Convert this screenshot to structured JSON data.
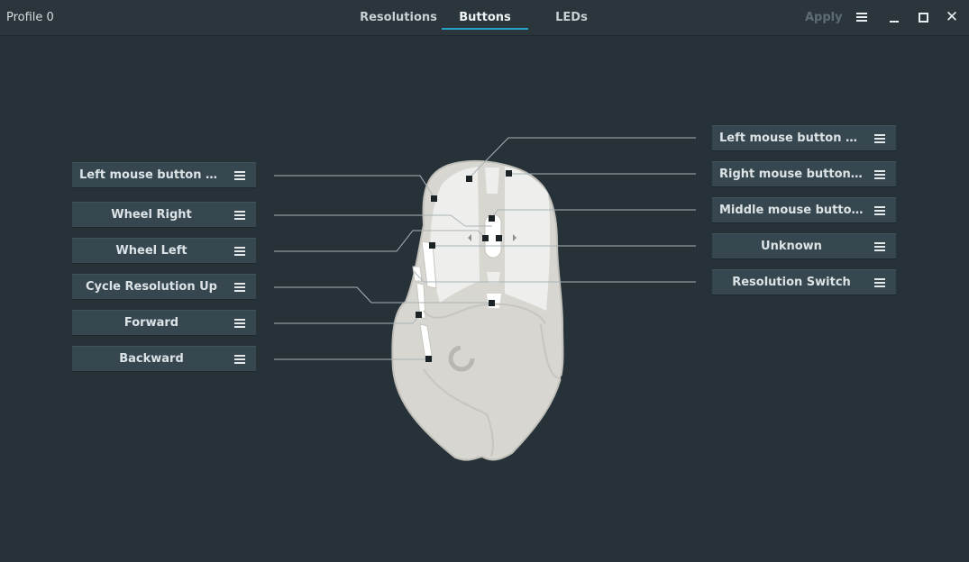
{
  "titlebar": {
    "profile": "Profile 0",
    "tabs": [
      "Resolutions",
      "Buttons",
      "LEDs"
    ],
    "active_tab": "Buttons",
    "apply_label": "Apply"
  },
  "left_buttons": [
    {
      "label": "Left mouse button click"
    },
    {
      "label": "Wheel Right"
    },
    {
      "label": "Wheel Left"
    },
    {
      "label": "Cycle Resolution Up"
    },
    {
      "label": "Forward"
    },
    {
      "label": "Backward"
    }
  ],
  "right_buttons": [
    {
      "label": "Left mouse button click"
    },
    {
      "label": "Right mouse button click"
    },
    {
      "label": "Middle mouse button c..."
    },
    {
      "label": "Unknown"
    },
    {
      "label": "Resolution Switch"
    }
  ],
  "colors": {
    "background": "#263238",
    "button": "#37474f",
    "accent": "#26a3c4",
    "mouse_body": "#d7d6d0",
    "mouse_keys": "#eeeeec"
  },
  "icons": {
    "menu": "hamburger-menu-icon",
    "minimize": "minimize-icon",
    "maximize": "maximize-icon",
    "close": "close-icon"
  }
}
